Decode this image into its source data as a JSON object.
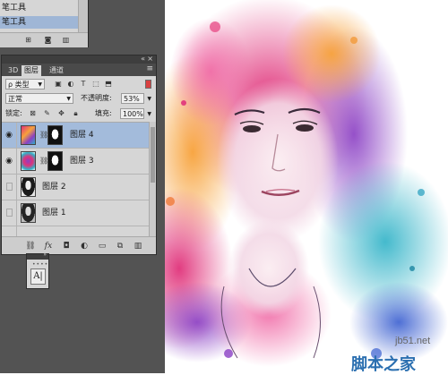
{
  "tool_panel": {
    "items": [
      "笔工具",
      "笔工具"
    ],
    "selected_index": 1,
    "bottom_icons": [
      "new-preset-icon",
      "camera-icon",
      "trash-icon"
    ]
  },
  "layers_panel": {
    "tabs": [
      "3D",
      "图层",
      "通道"
    ],
    "active_tab": "图层",
    "filter": {
      "kind_label": "ρ 类型",
      "filter_icons": [
        "image-filter-icon",
        "adjustment-filter-icon",
        "type-filter-icon",
        "shape-filter-icon",
        "smart-object-filter-icon"
      ]
    },
    "blend_mode": "正常",
    "opacity_label": "不透明度:",
    "opacity_value": "53%",
    "lock_label": "锁定:",
    "fill_label": "填充:",
    "fill_value": "100%",
    "layers": [
      {
        "name": "图层 4",
        "visible": true,
        "selected": true,
        "has_mask": true
      },
      {
        "name": "图层 3",
        "visible": true,
        "selected": false,
        "has_mask": true
      },
      {
        "name": "图层 2",
        "visible": false,
        "selected": false,
        "has_mask": false
      },
      {
        "name": "图层 1",
        "visible": false,
        "selected": false,
        "has_mask": false
      }
    ],
    "footer_icons": [
      "link-layers-icon",
      "fx-icon",
      "add-mask-icon",
      "adjustment-layer-icon",
      "group-folder-icon",
      "new-layer-icon",
      "trash-icon"
    ]
  },
  "character_panel": {
    "icon": "A|"
  },
  "watermark": {
    "url": "jb51.net",
    "name": "脚本之家"
  },
  "colors": {
    "app_bg": "#535353",
    "panel_bg": "#d6d6d6",
    "selection": "#a3bbdb",
    "watermark_blue": "#2b6fb0"
  }
}
